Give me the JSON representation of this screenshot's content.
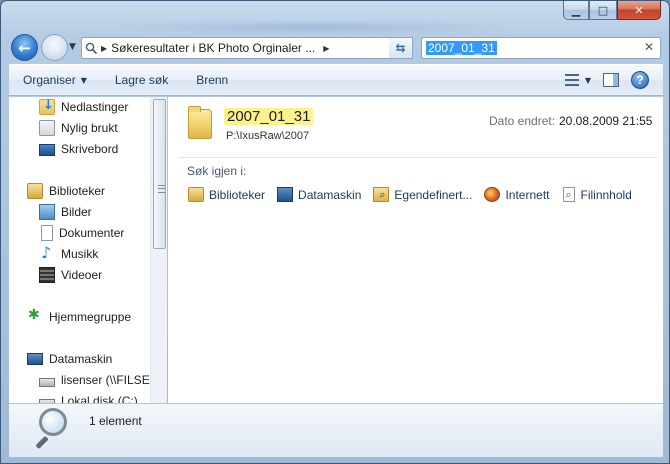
{
  "window": {
    "caption": {
      "minimize": "▁",
      "maximize": "□",
      "close": "✕"
    }
  },
  "address": {
    "back_icon": "back-arrow-icon",
    "forward_icon": "forward-arrow-icon",
    "path_text": "Søkeresultater i BK Photo Orginaler ...",
    "path_sep": "▶",
    "path_chevron": "▶",
    "dropdown": "▼",
    "refresh": "⇆"
  },
  "search": {
    "value": "2007_01_31",
    "clear": "✕"
  },
  "toolbar": {
    "organize": "Organiser",
    "save_search": "Lagre søk",
    "burn": "Brenn",
    "caret": "▼",
    "help": "?"
  },
  "sidebar": {
    "items": [
      {
        "label": "Nedlastinger",
        "icon": "downloads-icon"
      },
      {
        "label": "Nylig brukt",
        "icon": "recent-places-icon"
      },
      {
        "label": "Skrivebord",
        "icon": "desktop-icon"
      },
      {
        "label": "Biblioteker",
        "icon": "libraries-icon"
      },
      {
        "label": "Bilder",
        "icon": "pictures-icon"
      },
      {
        "label": "Dokumenter",
        "icon": "documents-icon"
      },
      {
        "label": "Musikk",
        "icon": "music-icon"
      },
      {
        "label": "Videoer",
        "icon": "videos-icon"
      },
      {
        "label": "Hjemmegruppe",
        "icon": "homegroup-icon"
      },
      {
        "label": "Datamaskin",
        "icon": "computer-icon"
      },
      {
        "label": "lisenser (\\\\FILSEV",
        "icon": "network-drive-icon"
      },
      {
        "label": "Lokal disk (C:)",
        "icon": "local-disk-icon"
      }
    ]
  },
  "result": {
    "name": "2007_01_31",
    "path": "P:\\IxusRaw\\2007",
    "date_label": "Dato endret:",
    "date_value": "20.08.2009 21:55"
  },
  "search_again": {
    "label": "Søk igjen i:",
    "items": [
      {
        "label": "Biblioteker",
        "icon": "libraries-icon"
      },
      {
        "label": "Datamaskin",
        "icon": "computer-icon"
      },
      {
        "label": "Egendefinert...",
        "icon": "custom-search-icon"
      },
      {
        "label": "Internett",
        "icon": "internet-icon"
      },
      {
        "label": "Filinnhold",
        "icon": "file-contents-icon"
      }
    ]
  },
  "status": {
    "text": "1 element"
  },
  "colors": {
    "selection": "#3399ff",
    "highlight": "#fbf28b",
    "link": "#1e395b"
  }
}
